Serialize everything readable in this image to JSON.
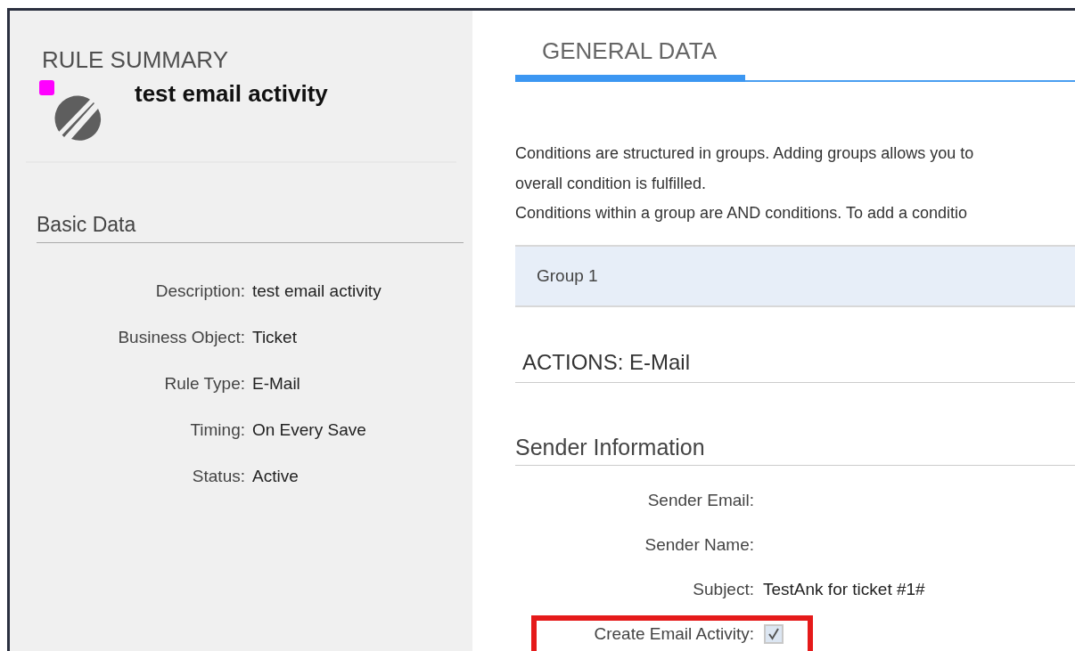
{
  "summary": {
    "heading": "RULE SUMMARY",
    "rule_name": "test email activity"
  },
  "basic_data": {
    "heading": "Basic Data",
    "fields": [
      {
        "label": "Description:",
        "value": "test email activity"
      },
      {
        "label": "Business Object:",
        "value": "Ticket"
      },
      {
        "label": "Rule Type:",
        "value": "E-Mail"
      },
      {
        "label": "Timing:",
        "value": "On Every Save"
      },
      {
        "label": "Status:",
        "value": "Active"
      }
    ]
  },
  "tabs": [
    {
      "label": "GENERAL DATA",
      "selected": true
    }
  ],
  "conditions": {
    "text_lines": [
      "Conditions are structured in groups. Adding groups allows you to",
      "overall condition is fulfilled.",
      "Conditions within a group are AND conditions. To add a conditio"
    ],
    "groups": [
      "Group 1"
    ]
  },
  "actions": {
    "heading": "ACTIONS: E-Mail"
  },
  "sender_information": {
    "heading": "Sender Information",
    "fields": [
      {
        "kind": "text",
        "label": "Sender Email:",
        "highlighted": false
      },
      {
        "kind": "text",
        "label": "Sender Name:",
        "highlighted": false
      },
      {
        "kind": "text",
        "label": "Subject:",
        "value": "TestAnk for ticket #1#",
        "highlighted": false
      },
      {
        "kind": "checkbox",
        "label": "Create Email Activity:",
        "checked": true,
        "highlighted": true
      }
    ]
  }
}
